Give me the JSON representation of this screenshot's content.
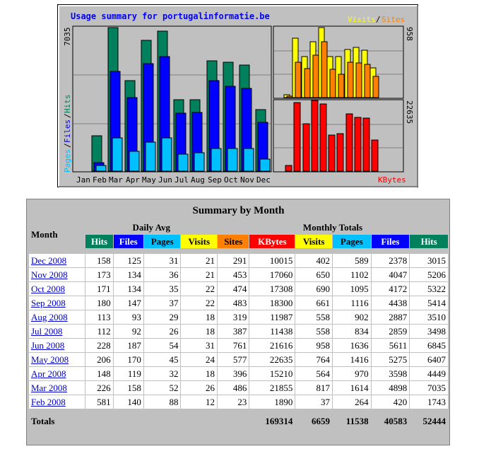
{
  "chart": {
    "title": "Usage summary for portugalinformatie.be",
    "legend_visits": "Visits",
    "legend_slash": "/",
    "legend_sites": "Sites",
    "left_scale_label": "7035",
    "right_top_scale_label": "958",
    "right_bottom_scale_label": "22635",
    "left_axis_pages": "Pages",
    "left_axis_files": "Files",
    "left_axis_hits": "Hits",
    "kbytes_label": "KBytes"
  },
  "chart_data": [
    {
      "type": "bar",
      "categories": [
        "Jan",
        "Feb",
        "Mar",
        "Apr",
        "May",
        "Jun",
        "Jul",
        "Aug",
        "Sep",
        "Oct",
        "Nov",
        "Dec"
      ],
      "series": [
        {
          "name": "Hits",
          "values": [
            0,
            1743,
            7035,
            4449,
            6407,
            6845,
            3498,
            3510,
            5414,
            5322,
            5206,
            3015
          ]
        },
        {
          "name": "Files",
          "values": [
            0,
            420,
            4898,
            3598,
            5275,
            5611,
            2859,
            2887,
            4438,
            4172,
            4047,
            2378
          ]
        },
        {
          "name": "Pages",
          "values": [
            0,
            264,
            1614,
            970,
            1416,
            1636,
            834,
            902,
            1116,
            1095,
            1102,
            589
          ]
        }
      ],
      "ylim": [
        0,
        7035
      ]
    },
    {
      "type": "bar",
      "categories": [
        "Feb 2008",
        "Mar 2008",
        "Apr 2008",
        "May 2008",
        "Jun 2008",
        "Jul 2008",
        "Aug 2008",
        "Sep 2008",
        "Oct 2008",
        "Nov 2008",
        "Dec 2008"
      ],
      "series": [
        {
          "name": "Visits",
          "values": [
            37,
            817,
            564,
            764,
            958,
            558,
            558,
            661,
            690,
            650,
            402
          ]
        },
        {
          "name": "Sites",
          "values": [
            23,
            486,
            396,
            577,
            761,
            387,
            319,
            483,
            474,
            453,
            291
          ]
        }
      ],
      "ylim": [
        0,
        958
      ]
    },
    {
      "type": "bar",
      "categories": [
        "Feb 2008",
        "Mar 2008",
        "Apr 2008",
        "May 2008",
        "Jun 2008",
        "Jul 2008",
        "Aug 2008",
        "Sep 2008",
        "Oct 2008",
        "Nov 2008",
        "Dec 2008"
      ],
      "series": [
        {
          "name": "KBytes",
          "values": [
            1890,
            21855,
            15210,
            22635,
            21616,
            11438,
            11987,
            18300,
            17308,
            17060,
            10015
          ]
        }
      ],
      "ylim": [
        0,
        22635
      ]
    }
  ],
  "colors": {
    "hits": "#00805c",
    "files": "#0000ff",
    "pages": "#00c0ff",
    "visits": "#ffff00",
    "sites": "#ff8000",
    "kbytes": "#ff0000",
    "title_blue": "#0000ff"
  },
  "summary": {
    "title": "Summary by Month",
    "month_header": "Month",
    "daily_avg_header": "Daily Avg",
    "monthly_totals_header": "Monthly Totals",
    "daily_cols": [
      "Hits",
      "Files",
      "Pages",
      "Visits"
    ],
    "monthly_cols": [
      "Sites",
      "KBytes",
      "Visits",
      "Pages",
      "Files",
      "Hits"
    ],
    "rows": [
      {
        "month": "Dec 2008",
        "v": [
          "158",
          "125",
          "31",
          "21",
          "291",
          "10015",
          "402",
          "589",
          "2378",
          "3015"
        ]
      },
      {
        "month": "Nov 2008",
        "v": [
          "173",
          "134",
          "36",
          "21",
          "453",
          "17060",
          "650",
          "1102",
          "4047",
          "5206"
        ]
      },
      {
        "month": "Oct 2008",
        "v": [
          "171",
          "134",
          "35",
          "22",
          "474",
          "17308",
          "690",
          "1095",
          "4172",
          "5322"
        ]
      },
      {
        "month": "Sep 2008",
        "v": [
          "180",
          "147",
          "37",
          "22",
          "483",
          "18300",
          "661",
          "1116",
          "4438",
          "5414"
        ]
      },
      {
        "month": "Aug 2008",
        "v": [
          "113",
          "93",
          "29",
          "18",
          "319",
          "11987",
          "558",
          "902",
          "2887",
          "3510"
        ]
      },
      {
        "month": "Jul 2008",
        "v": [
          "112",
          "92",
          "26",
          "18",
          "387",
          "11438",
          "558",
          "834",
          "2859",
          "3498"
        ]
      },
      {
        "month": "Jun 2008",
        "v": [
          "228",
          "187",
          "54",
          "31",
          "761",
          "21616",
          "958",
          "1636",
          "5611",
          "6845"
        ]
      },
      {
        "month": "May 2008",
        "v": [
          "206",
          "170",
          "45",
          "24",
          "577",
          "22635",
          "764",
          "1416",
          "5275",
          "6407"
        ]
      },
      {
        "month": "Apr 2008",
        "v": [
          "148",
          "119",
          "32",
          "18",
          "396",
          "15210",
          "564",
          "970",
          "3598",
          "4449"
        ]
      },
      {
        "month": "Mar 2008",
        "v": [
          "226",
          "158",
          "52",
          "26",
          "486",
          "21855",
          "817",
          "1614",
          "4898",
          "7035"
        ]
      },
      {
        "month": "Feb 2008",
        "v": [
          "581",
          "140",
          "88",
          "12",
          "23",
          "1890",
          "37",
          "264",
          "420",
          "1743"
        ]
      }
    ],
    "totals_label": "Totals",
    "totals": [
      "169314",
      "6659",
      "11538",
      "40583",
      "52444"
    ]
  }
}
